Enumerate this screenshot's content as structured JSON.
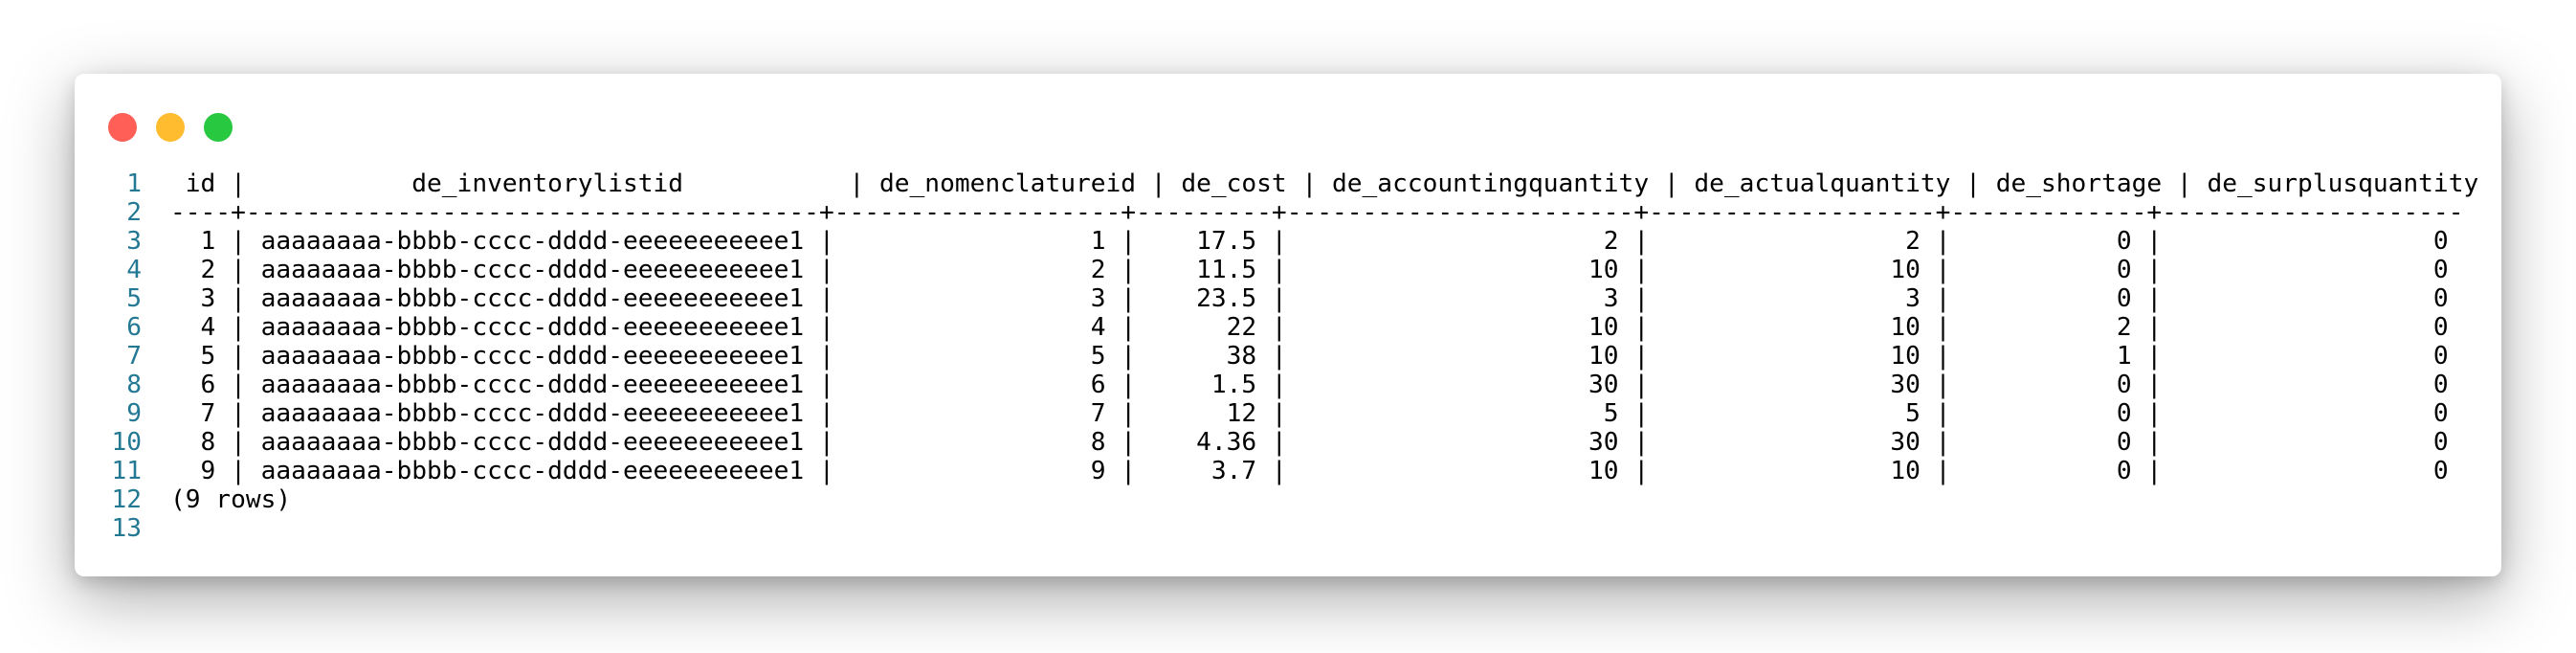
{
  "window": {
    "colors": {
      "close": "#ff5f57",
      "minimize": "#febc2e",
      "maximize": "#28c840",
      "line_number": "#237893",
      "text": "#000000"
    }
  },
  "lines": [
    {
      "num": "1",
      "text": " id |           de_inventorylistid           | de_nomenclatureid | de_cost | de_accountingquantity | de_actualquantity | de_shortage | de_surplusquantity"
    },
    {
      "num": "2",
      "text": "----+--------------------------------------+-------------------+---------+-----------------------+-------------------+-------------+--------------------"
    },
    {
      "num": "3",
      "text": "  1 | aaaaaaaa-bbbb-cccc-dddd-eeeeeeeeeee1 |                 1 |    17.5 |                     2 |                 2 |           0 |                  0"
    },
    {
      "num": "4",
      "text": "  2 | aaaaaaaa-bbbb-cccc-dddd-eeeeeeeeeee1 |                 2 |    11.5 |                    10 |                10 |           0 |                  0"
    },
    {
      "num": "5",
      "text": "  3 | aaaaaaaa-bbbb-cccc-dddd-eeeeeeeeeee1 |                 3 |    23.5 |                     3 |                 3 |           0 |                  0"
    },
    {
      "num": "6",
      "text": "  4 | aaaaaaaa-bbbb-cccc-dddd-eeeeeeeeeee1 |                 4 |      22 |                    10 |                10 |           2 |                  0"
    },
    {
      "num": "7",
      "text": "  5 | aaaaaaaa-bbbb-cccc-dddd-eeeeeeeeeee1 |                 5 |      38 |                    10 |                10 |           1 |                  0"
    },
    {
      "num": "8",
      "text": "  6 | aaaaaaaa-bbbb-cccc-dddd-eeeeeeeeeee1 |                 6 |     1.5 |                    30 |                30 |           0 |                  0"
    },
    {
      "num": "9",
      "text": "  7 | aaaaaaaa-bbbb-cccc-dddd-eeeeeeeeeee1 |                 7 |      12 |                     5 |                 5 |           0 |                  0"
    },
    {
      "num": "10",
      "text": "  8 | aaaaaaaa-bbbb-cccc-dddd-eeeeeeeeeee1 |                 8 |    4.36 |                    30 |                30 |           0 |                  0"
    },
    {
      "num": "11",
      "text": "  9 | aaaaaaaa-bbbb-cccc-dddd-eeeeeeeeeee1 |                 9 |     3.7 |                    10 |                10 |           0 |                  0"
    },
    {
      "num": "12",
      "text": "(9 rows)"
    },
    {
      "num": "13",
      "text": ""
    }
  ]
}
